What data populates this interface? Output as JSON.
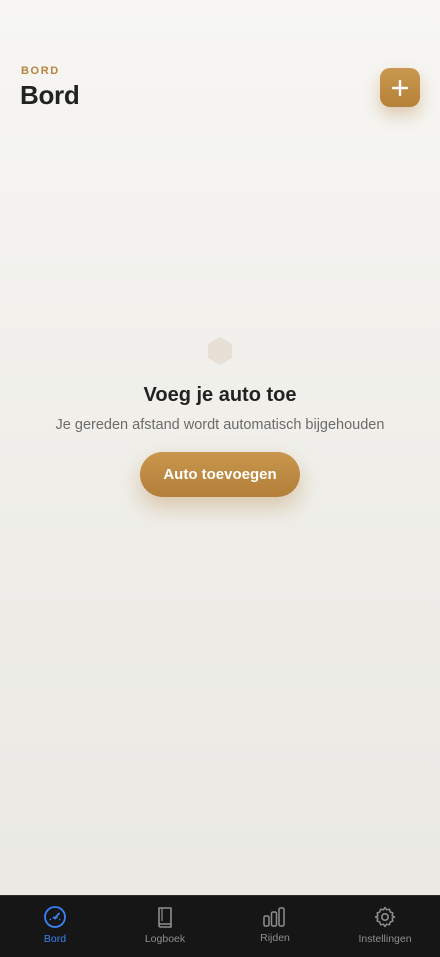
{
  "header": {
    "eyebrow": "BORD",
    "title": "Bord"
  },
  "add_button": {
    "icon": "plus-icon"
  },
  "empty_state": {
    "icon": "hexagon-icon",
    "title": "Voeg je auto toe",
    "subtitle": "Je gereden afstand wordt automatisch bijgehouden",
    "cta_label": "Auto toevoegen"
  },
  "tabbar": {
    "tabs": [
      {
        "label": "Bord",
        "icon": "speedometer-icon",
        "active": true
      },
      {
        "label": "Logboek",
        "icon": "book-icon",
        "active": false
      },
      {
        "label": "Rijden",
        "icon": "bar-chart-icon",
        "active": false
      },
      {
        "label": "Instellingen",
        "icon": "gear-icon",
        "active": false
      }
    ]
  },
  "colors": {
    "accent": "#b8843f",
    "active_tab": "#3a82f7",
    "tabbar_bg": "#161616"
  }
}
